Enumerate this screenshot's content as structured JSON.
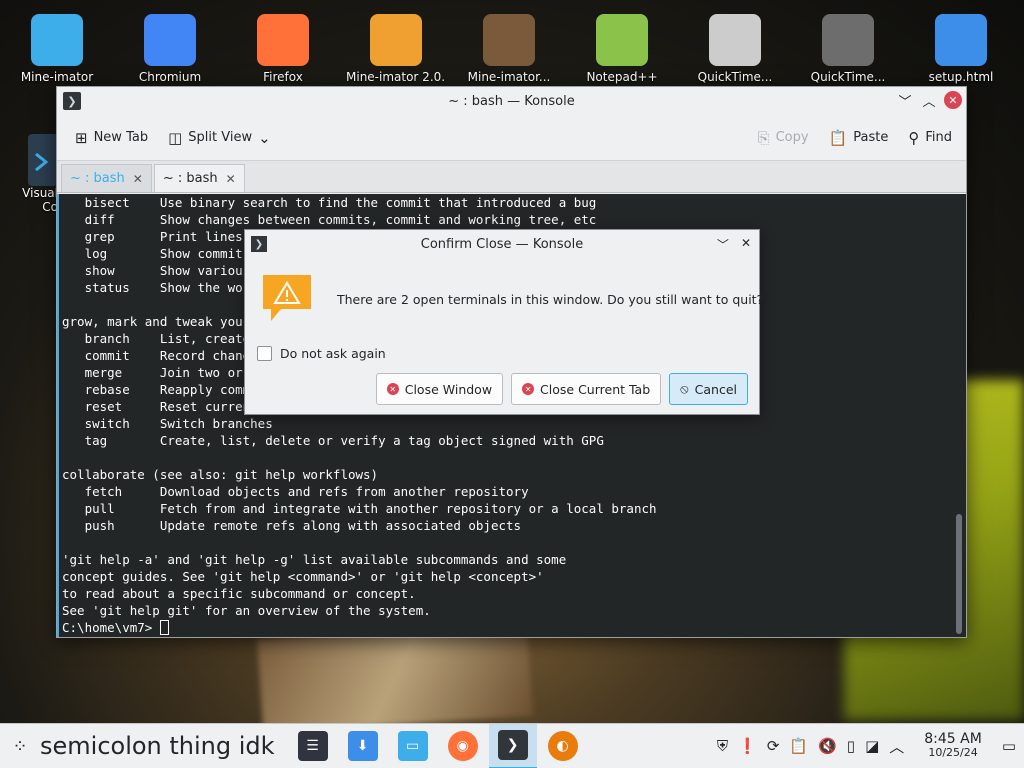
{
  "desktop": {
    "icons": [
      {
        "label": "Mine-imator",
        "icon": "folder-icon",
        "color": "#3daee9"
      },
      {
        "label": "Chromium",
        "icon": "chromium-icon",
        "color": "#4285f4"
      },
      {
        "label": "Firefox",
        "icon": "firefox-icon",
        "color": "#ff7139"
      },
      {
        "label": "Mine-imator 2.0...",
        "icon": "archive-icon",
        "color": "#f0a030"
      },
      {
        "label": "Mine-imator...",
        "icon": "mine-imator-icon",
        "color": "#7a5a3a"
      },
      {
        "label": "Notepad++",
        "icon": "notepad-plus-plus-icon",
        "color": "#8bc34a"
      },
      {
        "label": "QuickTime...",
        "icon": "quicktime-icon",
        "color": "#cccccc"
      },
      {
        "label": "QuickTime...",
        "icon": "quicktime-file-icon",
        "color": "#6d6d6d"
      },
      {
        "label": "setup.html",
        "icon": "html-file-icon",
        "color": "#3d8ee9"
      }
    ],
    "side_icons": [
      {
        "label": "Visual",
        "label2": "Co",
        "icon": "vscode-icon"
      }
    ]
  },
  "konsole": {
    "title": "~ : bash — Konsole",
    "toolbar": {
      "new_tab": "New Tab",
      "split_view": "Split View",
      "copy": "Copy",
      "paste": "Paste",
      "find": "Find"
    },
    "tabs": [
      {
        "label": "~ : bash",
        "active": false
      },
      {
        "label": "~ : bash",
        "active": true
      }
    ],
    "terminal_lines": [
      "   bisect    Use binary search to find the commit that introduced a bug",
      "   diff      Show changes between commits, commit and working tree, etc",
      "   grep      Print lines matching a pattern",
      "   log       Show commit logs",
      "   show      Show various types of objects",
      "   status    Show the working tree status",
      "",
      "grow, mark and tweak your common history",
      "   branch    List, create, or delete branches",
      "   commit    Record changes to the repository",
      "   merge     Join two or more development histories together",
      "   rebase    Reapply commits on top of another base tip",
      "   reset     Reset current HEAD to the specified state",
      "   switch    Switch branches",
      "   tag       Create, list, delete or verify a tag object signed with GPG",
      "",
      "collaborate (see also: git help workflows)",
      "   fetch     Download objects and refs from another repository",
      "   pull      Fetch from and integrate with another repository or a local branch",
      "   push      Update remote refs along with associated objects",
      "",
      "'git help -a' and 'git help -g' list available subcommands and some",
      "concept guides. See 'git help <command>' or 'git help <concept>'",
      "to read about a specific subcommand or concept.",
      "See 'git help git' for an overview of the system."
    ],
    "prompt": "C:\\home\\vm7> "
  },
  "dialog": {
    "title": "Confirm Close — Konsole",
    "message": "There are 2 open terminals in this window. Do you still want to quit?",
    "checkbox_label": "Do not ask again",
    "checkbox_checked": false,
    "buttons": {
      "close_window": "Close Window",
      "close_current_tab": "Close Current Tab",
      "cancel": "Cancel"
    }
  },
  "taskbar": {
    "label": "semicolon thing idk",
    "clock_time": "8:45 AM",
    "clock_date": "10/25/24"
  },
  "colors": {
    "accent": "#3daee9",
    "danger": "#da4453",
    "terminal_bg": "#232627",
    "terminal_fg": "#fcfcfc"
  }
}
